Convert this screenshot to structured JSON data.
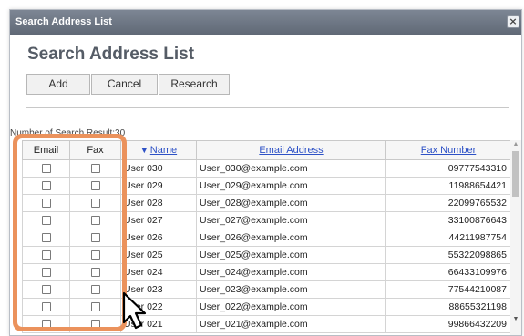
{
  "window": {
    "title": "Search Address List",
    "close_symbol": "×"
  },
  "page": {
    "heading": "Search Address List"
  },
  "toolbar": {
    "add_label": "Add",
    "cancel_label": "Cancel",
    "research_label": "Research"
  },
  "results": {
    "count_text": "Number of Search Result:30"
  },
  "table": {
    "headers": {
      "email": "Email",
      "fax": "Fax",
      "name": "Name",
      "name_sort_indicator": "▼",
      "email_address": "Email Address",
      "fax_number": "Fax Number"
    },
    "rows": [
      {
        "name": "User 030",
        "email": "User_030@example.com",
        "fax": "09777543310"
      },
      {
        "name": "User 029",
        "email": "User_029@example.com",
        "fax": "11988654421"
      },
      {
        "name": "User 028",
        "email": "User_028@example.com",
        "fax": "22099765532"
      },
      {
        "name": "User 027",
        "email": "User_027@example.com",
        "fax": "33100876643"
      },
      {
        "name": "User 026",
        "email": "User_026@example.com",
        "fax": "44211987754"
      },
      {
        "name": "User 025",
        "email": "User_025@example.com",
        "fax": "55322098865"
      },
      {
        "name": "User 024",
        "email": "User_024@example.com",
        "fax": "66433109976"
      },
      {
        "name": "User 023",
        "email": "User_023@example.com",
        "fax": "77544210087"
      },
      {
        "name": "User 022",
        "email": "User_022@example.com",
        "fax": "88655321198"
      },
      {
        "name": "User 021",
        "email": "User_021@example.com",
        "fax": "99866432209"
      }
    ]
  },
  "scrollbar": {
    "up_symbol": "▲",
    "down_symbol": "▼"
  },
  "colors": {
    "highlight": "#eb925c",
    "link": "#2d51c6",
    "titlebar": "#606976"
  }
}
